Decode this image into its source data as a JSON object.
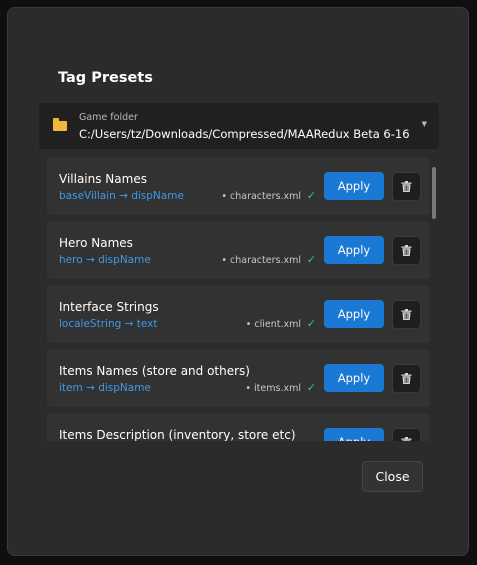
{
  "dialog": {
    "title": "Tag Presets"
  },
  "folder": {
    "label": "Game folder",
    "path": "C:/Users/tz/Downloads/Compressed/MAARedux Beta 6-16",
    "chevron_icon": "chevron-down-icon",
    "chevron_glyph": "▼",
    "folder_icon": "folder-icon"
  },
  "presets": [
    {
      "name": "Villains Names",
      "mapping": "baseVillain → dispName",
      "file": "• characters.xml",
      "check": "✓",
      "apply_label": "Apply"
    },
    {
      "name": "Hero Names",
      "mapping": "hero → dispName",
      "file": "• characters.xml",
      "check": "✓",
      "apply_label": "Apply"
    },
    {
      "name": "Interface Strings",
      "mapping": "localeString → text",
      "file": "• client.xml",
      "check": "✓",
      "apply_label": "Apply"
    },
    {
      "name": "Items Names (store and others)",
      "mapping": "item → dispName",
      "file": "• items.xml",
      "check": "✓",
      "apply_label": "Apply"
    },
    {
      "name": "Items Description (inventory, store etc)",
      "mapping": "",
      "file": "",
      "check": "",
      "apply_label": "Apply"
    }
  ],
  "footer": {
    "close_label": "Close"
  },
  "colors": {
    "accent": "#1a79d4",
    "mapping": "#3d9ae8",
    "check": "#4fc25d",
    "folder": "#f0b73a",
    "background": "#2b2b2b"
  }
}
